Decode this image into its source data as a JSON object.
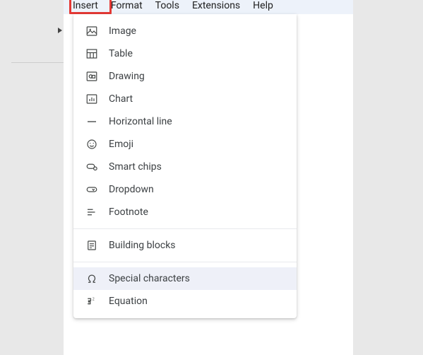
{
  "menubar": {
    "items": [
      {
        "label": "Insert"
      },
      {
        "label": "Format"
      },
      {
        "label": "Tools"
      },
      {
        "label": "Extensions"
      },
      {
        "label": "Help"
      }
    ]
  },
  "dropdown": {
    "items": [
      {
        "label": "Image"
      },
      {
        "label": "Table"
      },
      {
        "label": "Drawing"
      },
      {
        "label": "Chart"
      },
      {
        "label": "Horizontal line"
      },
      {
        "label": "Emoji"
      },
      {
        "label": "Smart chips"
      },
      {
        "label": "Dropdown"
      },
      {
        "label": "Footnote"
      },
      {
        "label": "Building blocks"
      },
      {
        "label": "Special characters"
      },
      {
        "label": "Equation"
      }
    ]
  }
}
